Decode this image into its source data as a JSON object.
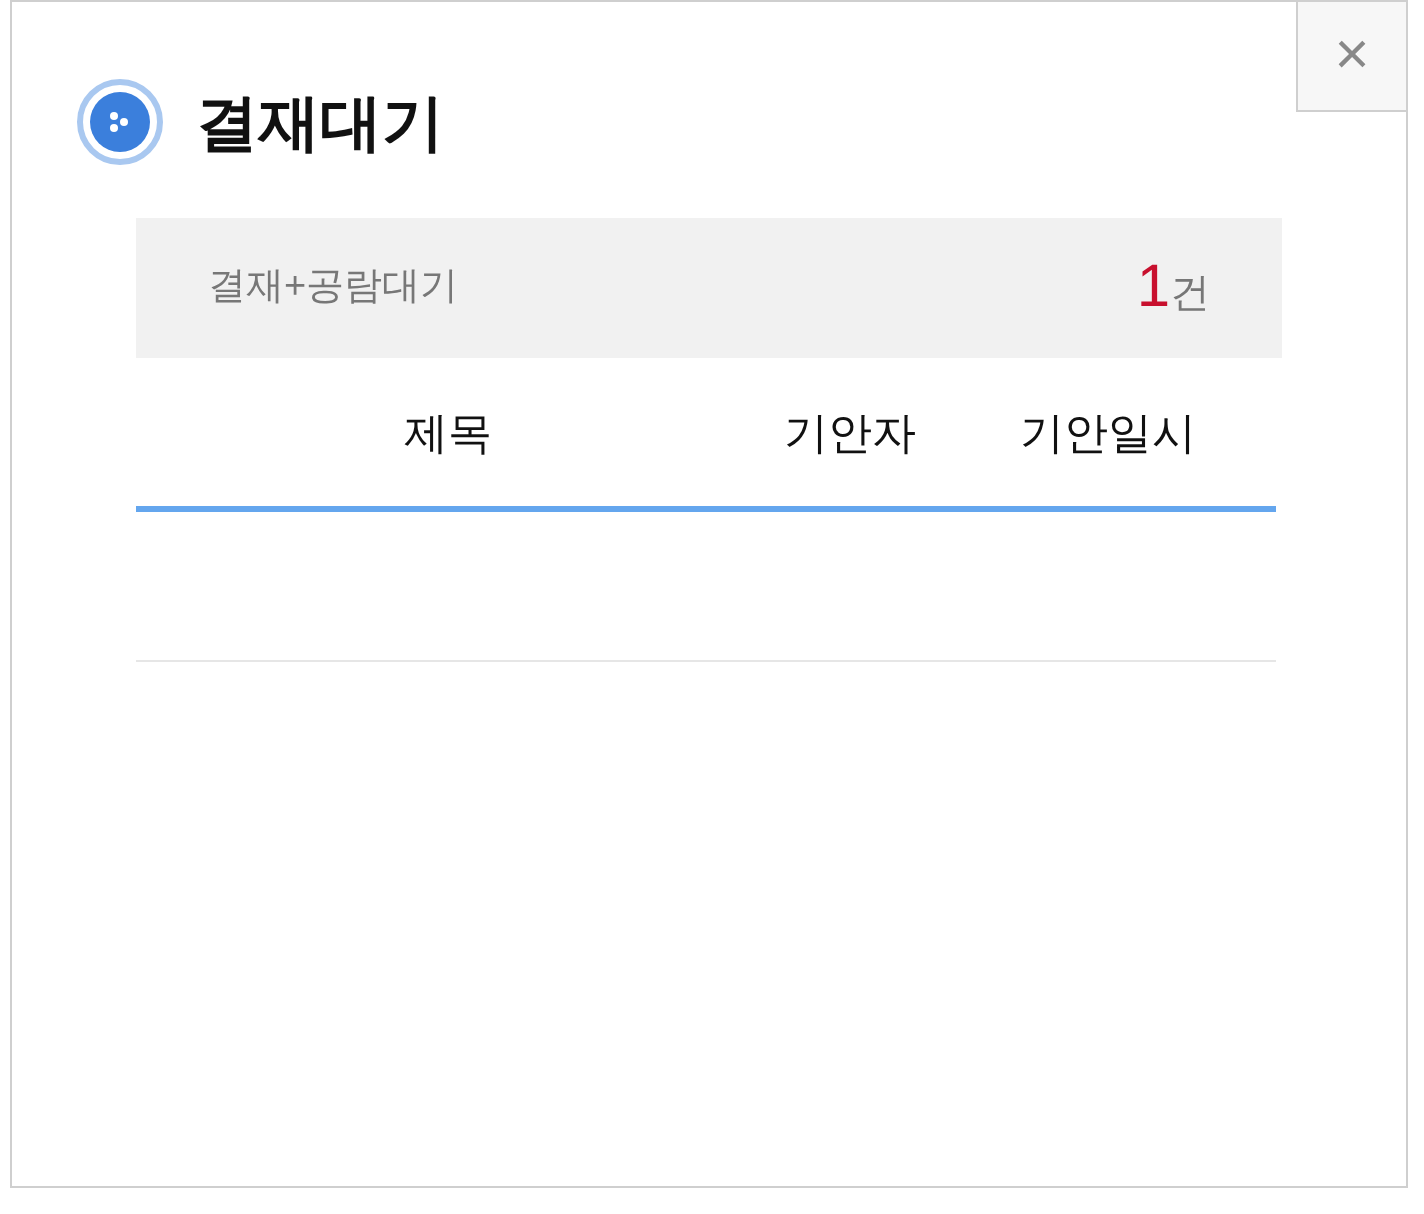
{
  "close_button": {
    "label": "×"
  },
  "title": "결재대기",
  "summary": {
    "label": "결재+공람대기",
    "count": "1",
    "unit": "건"
  },
  "table": {
    "columns": [
      "제목",
      "기안자",
      "기안일시"
    ]
  }
}
